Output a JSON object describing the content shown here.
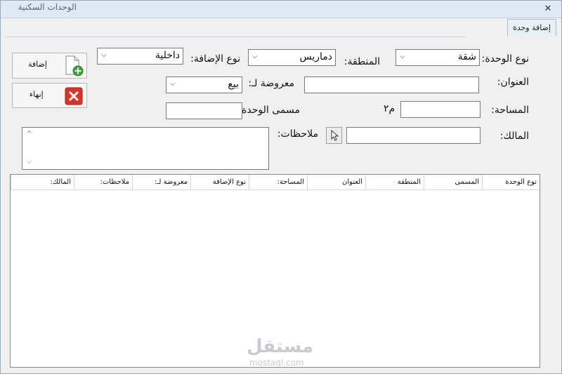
{
  "window": {
    "title": "الوحدات السكنية",
    "close_glyph": "✕"
  },
  "tab": {
    "label": "إضافة وحدة"
  },
  "form": {
    "unit_type": {
      "label": "نوع الوحدة:",
      "value": "شقة"
    },
    "region": {
      "label": "المنطقة:",
      "value": "دماريس"
    },
    "add_type": {
      "label": "نوع الإضافة:",
      "value": "داخلية"
    },
    "address": {
      "label": "العنوان:",
      "value": ""
    },
    "offered_for": {
      "label": "معروضة لـ:",
      "value": "بيع"
    },
    "area": {
      "label": "المساحة:",
      "value": "",
      "unit": "م٢"
    },
    "unit_name": {
      "label": "مسمى الوحدة:",
      "value": ""
    },
    "owner": {
      "label": "المالك:",
      "value": ""
    },
    "notes": {
      "label": "ملاحظات:",
      "value": ""
    }
  },
  "buttons": {
    "add": {
      "label": "إضافة"
    },
    "finish": {
      "label": "إنهاء"
    }
  },
  "table": {
    "columns": [
      "نوع الوحدة",
      "المسمى",
      "المنطقة",
      "العنوان",
      "المساحة:",
      "نوع الإضافة",
      "معروضة لـ:",
      "ملاحظات:",
      "المالك:"
    ]
  },
  "watermark": {
    "arabic": "مستقل",
    "latin": "mostaql.com"
  },
  "colors": {
    "titlebar": "#dfe8f4",
    "window": "#f0f0f0",
    "add_icon_green": "#3aa537",
    "delete_icon_red": "#d9342b"
  }
}
